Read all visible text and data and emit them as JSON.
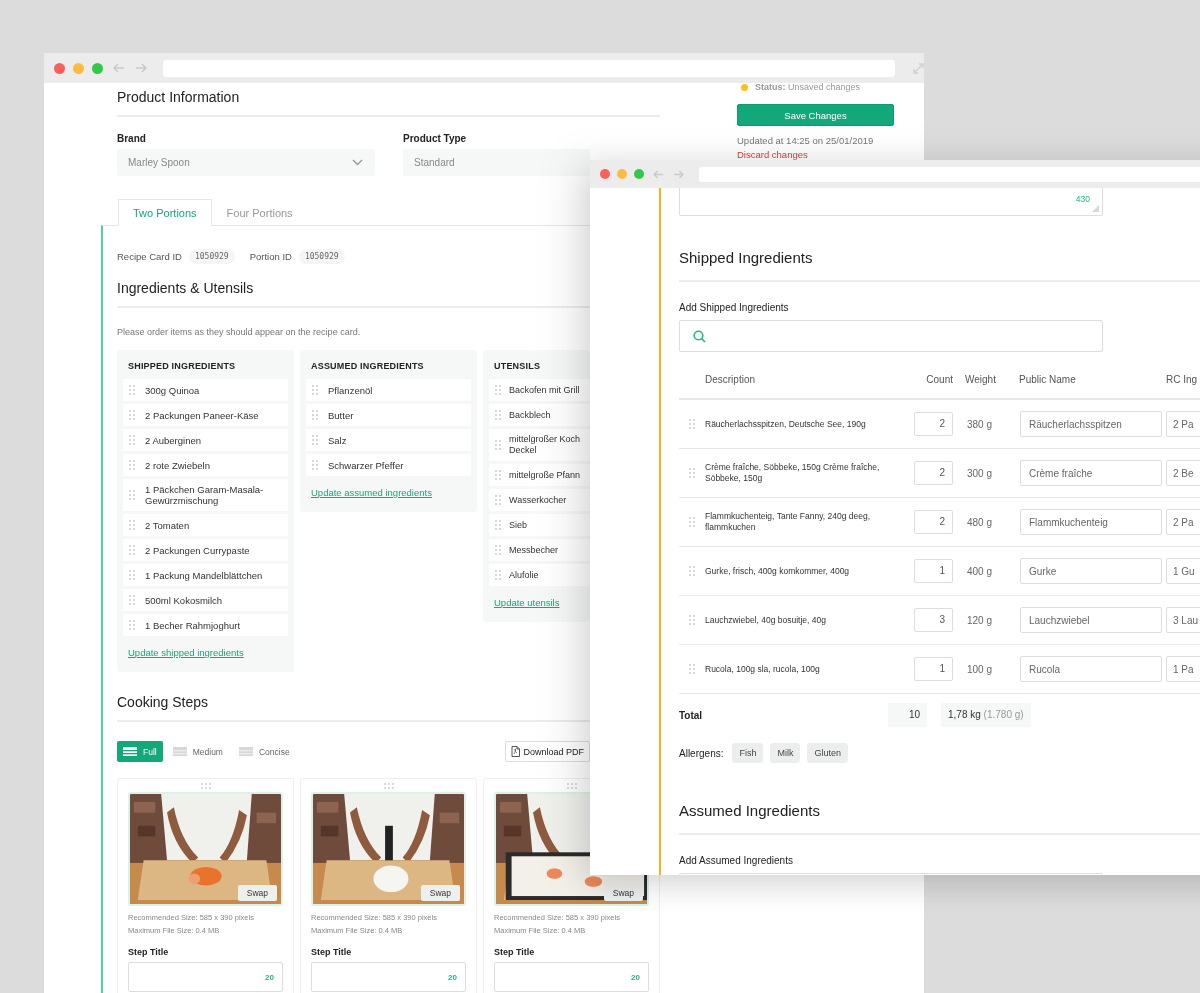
{
  "back_window": {
    "product_information": {
      "title": "Product Information",
      "fields": [
        {
          "label": "Brand",
          "value": "Marley Spoon",
          "caret": true
        },
        {
          "label": "Product Type",
          "value": "Standard",
          "caret": false
        }
      ]
    },
    "tabs": [
      {
        "label": "Two Portions",
        "selected": true
      },
      {
        "label": "Four Portions",
        "selected": false
      }
    ],
    "ids": [
      {
        "label": "Recipe Card ID",
        "value": "1050929"
      },
      {
        "label": "Portion ID",
        "value": "1050929"
      }
    ],
    "ingredients": {
      "title": "Ingredients & Utensils",
      "note": "Please order items as they should appear on the recipe card.",
      "columns": [
        {
          "title": "SHIPPED INGREDIENTS",
          "items": [
            "300g Quinoa",
            "2 Packungen Paneer-Käse",
            "2 Auberginen",
            "2 rote Zwiebeln",
            "1 Päckchen Garam-Masala-\nGewürzmischung",
            "2 Tomaten",
            "2 Packungen Currypaste",
            "1 Packung Mandelblättchen",
            "500ml Kokosmilch",
            "1 Becher Rahmjoghurt"
          ],
          "link": "Update shipped ingredients"
        },
        {
          "title": "ASSUMED INGREDIENTS",
          "items": [
            "Pflanzenöl",
            "Butter",
            "Salz",
            "Schwarzer Pfeffer"
          ],
          "link": "Update assumed ingredients"
        },
        {
          "title": "UTENSILS",
          "items": [
            "Backofen mit Grill",
            "Backblech",
            "mittelgroßer Koch\nDeckel",
            "mittelgroße Pfann",
            "Wasserkocher",
            "Sieb",
            "Messbecher",
            "Alufolie"
          ],
          "link": "Update utensils"
        }
      ]
    },
    "cooking_steps": {
      "title": "Cooking Steps",
      "modes": [
        {
          "label": "Full",
          "selected": true
        },
        {
          "label": "Medium",
          "selected": false
        },
        {
          "label": "Concise",
          "selected": false
        }
      ],
      "download": "Download PDF",
      "steps": [
        {
          "swap": "Swap",
          "size_note": "Recommended Size: 585 x 390 pixels",
          "file_note": "Maximum File Size: 0.4 MB",
          "title_label": "Step Title",
          "counter": "20"
        },
        {
          "swap": "Swap",
          "size_note": "Recommended Size: 585 x 390 pixels",
          "file_note": "Maximum File Size: 0.4 MB",
          "title_label": "Step Title",
          "counter": "20"
        },
        {
          "swap": "Swap",
          "size_note": "Recommended Size: 585 x 390 pixels",
          "file_note": "Maximum File Size: 0.4 MB",
          "title_label": "Step Title",
          "counter": "20"
        }
      ]
    },
    "sidebar": {
      "status": "**Status:** Unsaved changes",
      "save": "Save Changes",
      "updated": "Updated at 14:25 on 25/01/2019",
      "discard": "Discard changes"
    }
  },
  "front_window": {
    "description_counter": "430",
    "shipped": {
      "title": "Shipped Ingredients",
      "add_label": "Add Shipped Ingredients",
      "columns": [
        "Description",
        "Count",
        "Weight",
        "Public Name",
        "RC Ing"
      ],
      "rows": [
        {
          "description": "Räucherlachsspitzen, Deutsche See, 190g",
          "count": "2",
          "weight": "380 g",
          "public_name": "Räucherlachsspitzen",
          "rc": "2 Pa"
        },
        {
          "description": "Crème fraîche, Söbbeke, 150g Crème fraîche, Söbbeke, 150g",
          "count": "2",
          "weight": "300 g",
          "public_name": "Crème fraîche",
          "rc": "2 Be"
        },
        {
          "description": "Flammkuchenteig, Tante Fanny, 240g deeg, flammkuchen",
          "count": "2",
          "weight": "480 g",
          "public_name": "Flammkuchenteig",
          "rc": "2 Pa"
        },
        {
          "description": "Gurke, frisch, 400g komkommer, 400g",
          "count": "1",
          "weight": "400 g",
          "public_name": "Gurke",
          "rc": "1 Gu"
        },
        {
          "description": "Lauchzwiebel, 40g bosuitje, 40g",
          "count": "3",
          "weight": "120 g",
          "public_name": "Lauchzwiebel",
          "rc": "3 Lau"
        },
        {
          "description": "Rucola, 100g sla, rucola, 100g",
          "count": "1",
          "weight": "100 g",
          "public_name": "Rucola",
          "rc": "1 Pa"
        }
      ],
      "total": {
        "label": "Total",
        "count": "10",
        "weight": "1,78 kg",
        "weight_detail": "(1.780 g)"
      },
      "allergens": {
        "label": "Allergens:",
        "tags": [
          "Fish",
          "Milk",
          "Gluten"
        ]
      }
    },
    "assumed": {
      "title": "Assumed Ingredients",
      "add_label": "Add Assumed Ingredients"
    }
  }
}
